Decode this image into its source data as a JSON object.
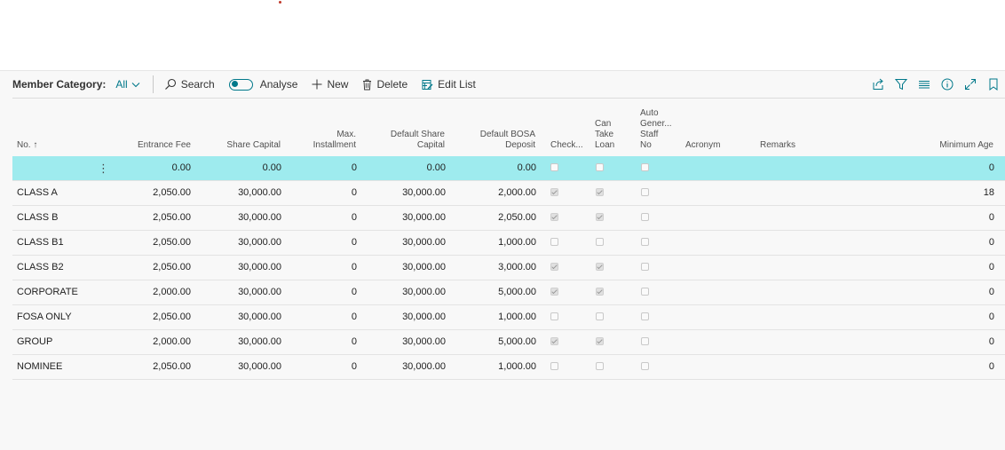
{
  "toolbar": {
    "title": "Member Category:",
    "filter_value": "All",
    "search_label": "Search",
    "analyse_label": "Analyse",
    "new_label": "New",
    "delete_label": "Delete",
    "edit_list_label": "Edit List",
    "accent_color": "#00788a"
  },
  "columns": {
    "no": "No. ↑",
    "entrance_fee": "Entrance Fee",
    "share_capital": "Share Capital",
    "max_installment_1": "Max.",
    "max_installment_2": "Installment",
    "default_share_1": "Default Share",
    "default_share_2": "Capital",
    "default_bosa_1": "Default BOSA",
    "default_bosa_2": "Deposit",
    "check": "Check...",
    "can_take_1": "Can",
    "can_take_2": "Take",
    "can_take_3": "Loan",
    "auto_gen_1": "Auto",
    "auto_gen_2": "Gener...",
    "auto_gen_3": "Staff",
    "auto_gen_4": "No",
    "acronym": "Acronym",
    "remarks": "Remarks",
    "minimum_age": "Minimum Age"
  },
  "rows": [
    {
      "no": "",
      "entrance_fee": "0.00",
      "share_capital": "0.00",
      "max_installment": "0",
      "default_share_capital": "0.00",
      "default_bosa_deposit": "0.00",
      "check": false,
      "can_take_loan": false,
      "auto_gen": false,
      "acronym": "",
      "remarks": "",
      "minimum_age": "0",
      "selected": true
    },
    {
      "no": "CLASS A",
      "entrance_fee": "2,050.00",
      "share_capital": "30,000.00",
      "max_installment": "0",
      "default_share_capital": "30,000.00",
      "default_bosa_deposit": "2,000.00",
      "check": true,
      "can_take_loan": true,
      "auto_gen": false,
      "acronym": "",
      "remarks": "",
      "minimum_age": "18"
    },
    {
      "no": "CLASS B",
      "entrance_fee": "2,050.00",
      "share_capital": "30,000.00",
      "max_installment": "0",
      "default_share_capital": "30,000.00",
      "default_bosa_deposit": "2,050.00",
      "check": true,
      "can_take_loan": true,
      "auto_gen": false,
      "acronym": "",
      "remarks": "",
      "minimum_age": "0"
    },
    {
      "no": "CLASS B1",
      "entrance_fee": "2,050.00",
      "share_capital": "30,000.00",
      "max_installment": "0",
      "default_share_capital": "30,000.00",
      "default_bosa_deposit": "1,000.00",
      "check": false,
      "can_take_loan": false,
      "auto_gen": false,
      "acronym": "",
      "remarks": "",
      "minimum_age": "0"
    },
    {
      "no": "CLASS B2",
      "entrance_fee": "2,050.00",
      "share_capital": "30,000.00",
      "max_installment": "0",
      "default_share_capital": "30,000.00",
      "default_bosa_deposit": "3,000.00",
      "check": true,
      "can_take_loan": true,
      "auto_gen": false,
      "acronym": "",
      "remarks": "",
      "minimum_age": "0"
    },
    {
      "no": "CORPORATE",
      "entrance_fee": "2,000.00",
      "share_capital": "30,000.00",
      "max_installment": "0",
      "default_share_capital": "30,000.00",
      "default_bosa_deposit": "5,000.00",
      "check": true,
      "can_take_loan": true,
      "auto_gen": false,
      "acronym": "",
      "remarks": "",
      "minimum_age": "0"
    },
    {
      "no": "FOSA ONLY",
      "entrance_fee": "2,050.00",
      "share_capital": "30,000.00",
      "max_installment": "0",
      "default_share_capital": "30,000.00",
      "default_bosa_deposit": "1,000.00",
      "check": false,
      "can_take_loan": false,
      "auto_gen": false,
      "acronym": "",
      "remarks": "",
      "minimum_age": "0"
    },
    {
      "no": "GROUP",
      "entrance_fee": "2,000.00",
      "share_capital": "30,000.00",
      "max_installment": "0",
      "default_share_capital": "30,000.00",
      "default_bosa_deposit": "5,000.00",
      "check": true,
      "can_take_loan": true,
      "auto_gen": false,
      "acronym": "",
      "remarks": "",
      "minimum_age": "0"
    },
    {
      "no": "NOMINEE",
      "entrance_fee": "2,050.00",
      "share_capital": "30,000.00",
      "max_installment": "0",
      "default_share_capital": "30,000.00",
      "default_bosa_deposit": "1,000.00",
      "check": false,
      "can_take_loan": false,
      "auto_gen": false,
      "acronym": "",
      "remarks": "",
      "minimum_age": "0"
    }
  ]
}
